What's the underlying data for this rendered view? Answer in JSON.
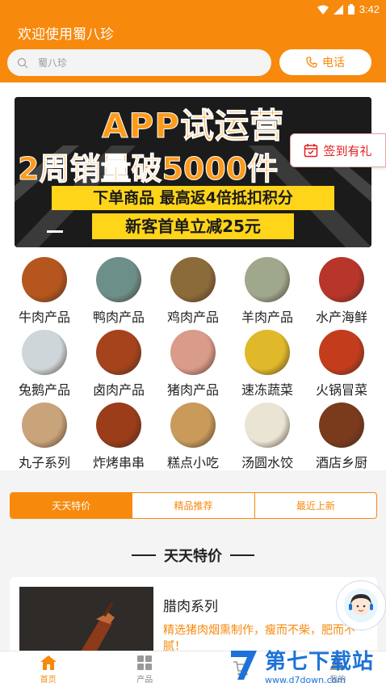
{
  "status_bar": {
    "time": "3:42",
    "icons": [
      "wifi-icon",
      "signal-icon",
      "battery-icon"
    ]
  },
  "header": {
    "welcome": "欢迎使用蜀八珍",
    "search_placeholder": "蜀八珍",
    "phone_label": "电话",
    "brand_color": "#f7890d"
  },
  "banner": {
    "line1": "APP试运营",
    "line2": "2周销量破5000件",
    "line3": "下单商品 最高返4倍抵扣积分",
    "line4": "新客首单立减25元",
    "checkin_label": "签到有礼"
  },
  "categories": [
    {
      "label": "牛肉产品",
      "icon": "cattle-icon",
      "color": "#b5561e"
    },
    {
      "label": "鸭肉产品",
      "icon": "duck-icon",
      "color": "#6d8f8a"
    },
    {
      "label": "鸡肉产品",
      "icon": "chicken-icon",
      "color": "#8c6b3a"
    },
    {
      "label": "羊肉产品",
      "icon": "goat-icon",
      "color": "#9fa88c"
    },
    {
      "label": "水产海鲜",
      "icon": "seafood-icon",
      "color": "#b8352a"
    },
    {
      "label": "兔鹅产品",
      "icon": "goose-icon",
      "color": "#cfd6d9"
    },
    {
      "label": "卤肉产品",
      "icon": "braised-meat-icon",
      "color": "#a5431c"
    },
    {
      "label": "猪肉产品",
      "icon": "pig-icon",
      "color": "#d99b8a"
    },
    {
      "label": "速冻蔬菜",
      "icon": "frozen-vegetables-icon",
      "color": "#e0b92a"
    },
    {
      "label": "火锅冒菜",
      "icon": "hotpot-icon",
      "color": "#c33d1c"
    },
    {
      "label": "丸子系列",
      "icon": "meatball-icon",
      "color": "#c9a37a"
    },
    {
      "label": "炸烤串串",
      "icon": "skewer-icon",
      "color": "#9a3d18"
    },
    {
      "label": "糕点小吃",
      "icon": "pastry-icon",
      "color": "#c99a5a"
    },
    {
      "label": "汤圆水饺",
      "icon": "dumpling-icon",
      "color": "#e9e4d4"
    },
    {
      "label": "酒店乡厨",
      "icon": "cured-meat-icon",
      "color": "#7a3a1c"
    }
  ],
  "tabs": [
    {
      "label": "天天特价",
      "active": true
    },
    {
      "label": "精品推荐",
      "active": false
    },
    {
      "label": "最近上新",
      "active": false
    }
  ],
  "section_title": "天天特价",
  "product": {
    "title": "腊肉系列",
    "desc": "精选猪肉烟熏制作，瘦而不柴，肥而不腻！"
  },
  "bottom_nav": [
    {
      "label": "首页",
      "icon": "home-icon",
      "active": true
    },
    {
      "label": "产品",
      "icon": "grid-icon",
      "active": false
    },
    {
      "label": "",
      "icon": "cart-icon",
      "active": false
    },
    {
      "label": "我的",
      "icon": "user-icon",
      "active": false
    }
  ],
  "watermark": {
    "title": "第七下载站",
    "url": "www.d7down.com"
  }
}
